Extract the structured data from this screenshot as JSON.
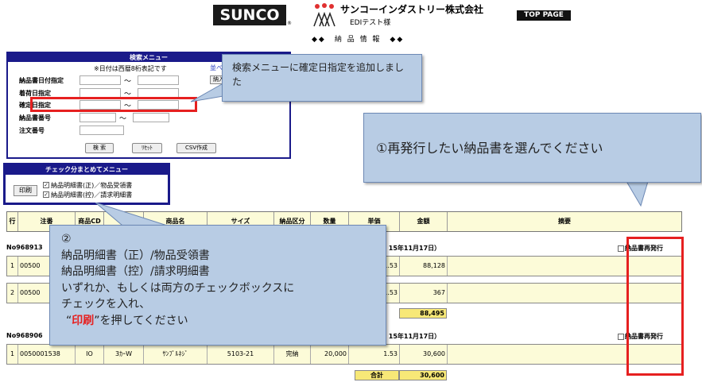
{
  "header": {
    "logo": "SUNCO",
    "logo_mark": "®",
    "company_name": "サンコーインダストリー株式会社",
    "company_sub": "EDIテスト様",
    "top_page": "TOP PAGE",
    "page_title": "◆◆　納 品 情 報　◆◆"
  },
  "search_menu": {
    "title": "検索メニュー",
    "note": "※日付は西暦8桁表記です",
    "link_text": "並べ",
    "small_button": "納入",
    "fields": [
      {
        "label": "納品書日付指定",
        "range": true
      },
      {
        "label": "着荷日指定",
        "range": true
      },
      {
        "label": "確定日指定",
        "range": true
      },
      {
        "label": "納品書番号",
        "range": true
      },
      {
        "label": "注文番号",
        "range": false
      }
    ],
    "tilde": "～",
    "buttons": [
      "検 索",
      "ﾘｾｯﾄ",
      "CSV作成"
    ]
  },
  "check_menu": {
    "title": "チェック分まとめてメニュー",
    "print_button": "印刷",
    "checkmark": "✓",
    "options": [
      "納品明細書(正)／物品受領書",
      "納品明細書(控)／請求明細書"
    ]
  },
  "table": {
    "columns": [
      "行",
      "注番",
      "商品CD",
      "",
      "商品名",
      "サイズ",
      "納品区分",
      "数量",
      "単価",
      "金額",
      "摘要"
    ],
    "reissue_label": "納品書再発行",
    "total_label": "合計",
    "groups": [
      {
        "doc_no": "No968913",
        "date_text": "日 15年11月17日）",
        "rows": [
          {
            "line": "1",
            "order": "00500",
            "unit_price": "1.53",
            "amount": "88,128"
          },
          {
            "line": "2",
            "order": "00500",
            "unit_price": "1.53",
            "amount": "367"
          }
        ],
        "total": "88,495"
      },
      {
        "doc_no": "No968906",
        "date_text": "日 15年11月17日）",
        "rows": [
          {
            "line": "1",
            "order": "0050001538",
            "code": "IO",
            "code2": "3ｶｰW",
            "name": "ｻﾝﾌﾟﾙﾈｼﾞ",
            "size": "5103-21",
            "kubun": "完納",
            "qty": "20,000",
            "unit_price": "1.53",
            "amount": "30,600"
          }
        ],
        "total": "30,600"
      }
    ]
  },
  "callouts": {
    "c1": "検索メニューに確定日指定を追加しました",
    "c2": "①再発行したい納品書を選んでください",
    "c3_lines": [
      "②",
      "納品明細書（正）/物品受領書",
      "納品明細書（控）/請求明細書",
      "いずれか、もしくは両方のチェックボックスに",
      "チェックを入れ、"
    ],
    "c3_last_pre": "“",
    "c3_last_red": "印刷",
    "c3_last_post": "”を押してください"
  },
  "colors": {
    "menu_header": "#1a1a8a",
    "callout_bg": "#b8cce4",
    "highlight_red": "#e62020",
    "table_row_bg": "#fcfbd8",
    "total_bg": "#f7e877"
  }
}
